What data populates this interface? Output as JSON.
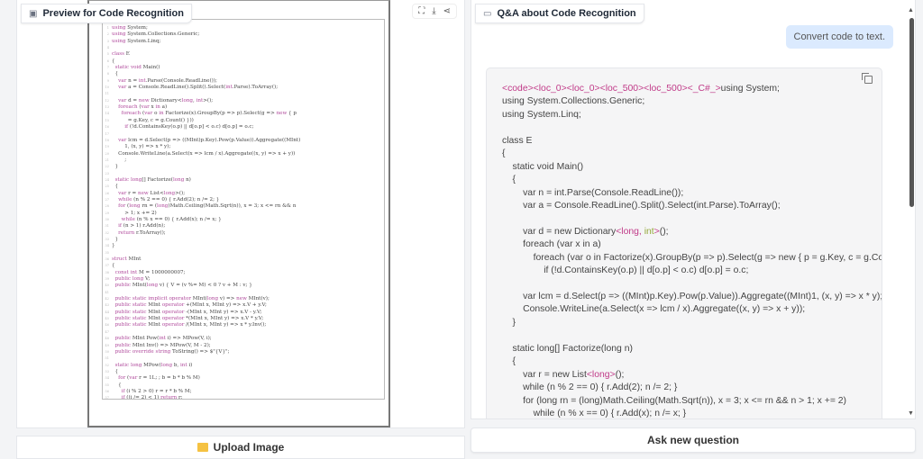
{
  "left_panel": {
    "title": "Preview for Code Recognition",
    "icons": [
      "image-icon",
      "fullscreen-icon",
      "download-icon",
      "share-icon"
    ],
    "code_image_lines": [
      "using System;",
      "using System.Collections.Generic;",
      "using System.Linq;",
      "",
      "class E",
      "{",
      "  static void Main()",
      "  {",
      "    var n = int.Parse(Console.ReadLine());",
      "    var a = Console.ReadLine().Split().Select(int.Parse).ToArray();",
      "",
      "    var d = new Dictionary<long, int>();",
      "    foreach (var x in a)",
      "      foreach (var o in Factorize(x).GroupBy(p => p).Select(g => new { p",
      "          = g.Key, c = g.Count() }))",
      "        if (!d.ContainsKey(o.p) || d[o.p] < o.c) d[o.p] = o.c;",
      "",
      "    var lcm = d.Select(p => ((MInt)p.Key).Pow(p.Value)).Aggregate((MInt)",
      "        1, (x, y) => x * y);",
      "    Console.WriteLine(a.Select(x => lcm / x).Aggregate((x, y) => x + y))",
      "        ;",
      "  }",
      "",
      "  static long[] Factorize(long n)",
      "  {",
      "    var r = new List<long>();",
      "    while (n % 2 == 0) { r.Add(2); n /= 2; }",
      "    for (long rn = (long)Math.Ceiling(Math.Sqrt(n)), x = 3; x <= rn && n",
      "        > 1; x += 2)",
      "      while (n % x == 0) { r.Add(x); n /= x; }",
      "    if (n > 1) r.Add(n);",
      "    return r.ToArray();",
      "  }",
      "}",
      "",
      "struct MInt",
      "{",
      "  const int M = 1000000007;",
      "  public long V;",
      "  public MInt(long v) { V = (v %= M) < 0 ? v + M : v; }",
      "",
      "  public static implicit operator MInt(long v) => new MInt(v);",
      "  public static MInt operator +(MInt x, MInt y) => x.V + y.V;",
      "  public static MInt operator -(MInt x, MInt y) => x.V - y.V;",
      "  public static MInt operator *(MInt x, MInt y) => x.V * y.V;",
      "  public static MInt operator /(MInt x, MInt y) => x * y.Inv();",
      "",
      "  public MInt Pow(int i) => MPow(V, i);",
      "  public MInt Inv() => MPow(V, M - 2);",
      "  public override string ToString() => $\"{V}\";",
      "",
      "  static long MPow(long b, int i)",
      "  {",
      "    for (var r = 1L; ; b = b * b % M)",
      "    {",
      "      if (i % 2 > 0) r = r * b % M;",
      "      if ((i /= 2) < 1) return r;",
      "    }",
      "  }",
      "}"
    ],
    "upload_label": "Upload Image"
  },
  "right_panel": {
    "title": "Q&A about Code Recognition",
    "user_message": "Convert code to text.",
    "answer_lines": [
      [
        {
          "t": "<code><loc_0><loc_0><loc_500><loc_500><_C#_>",
          "c": "tag"
        },
        {
          "t": "using System;"
        }
      ],
      [
        {
          "t": "using System.Collections.Generic;"
        }
      ],
      [
        {
          "t": "using System.Linq;"
        }
      ],
      [
        {
          "t": ""
        }
      ],
      [
        {
          "t": "class E"
        }
      ],
      [
        {
          "t": "{"
        }
      ],
      [
        {
          "t": "    static void Main()"
        }
      ],
      [
        {
          "t": "    {"
        }
      ],
      [
        {
          "t": "        var n = int.Parse(Console.ReadLine());"
        }
      ],
      [
        {
          "t": "        var a = Console.ReadLine().Split().Select(int.Parse).ToArray();"
        }
      ],
      [
        {
          "t": ""
        }
      ],
      [
        {
          "t": "        var d = new Dictionary"
        },
        {
          "t": "<long, ",
          "c": "tag"
        },
        {
          "t": "int",
          "c": "grn"
        },
        {
          "t": ">",
          "c": "tag"
        },
        {
          "t": "();"
        }
      ],
      [
        {
          "t": "        foreach (var x in a)"
        }
      ],
      [
        {
          "t": "            foreach (var o in Factorize(x).GroupBy(p => p).Select(g => new { p = g.Key, c = g.Count() }))"
        }
      ],
      [
        {
          "t": "                if (!d.ContainsKey(o.p) || d[o.p] < o.c) d[o.p] = o.c;"
        }
      ],
      [
        {
          "t": ""
        }
      ],
      [
        {
          "t": "        var lcm = d.Select(p => ((MInt)p.Key).Pow(p.Value)).Aggregate((MInt)1, (x, y) => x * y);"
        }
      ],
      [
        {
          "t": "        Console.WriteLine(a.Select(x => lcm / x).Aggregate((x, y) => x + y));"
        }
      ],
      [
        {
          "t": "    }"
        }
      ],
      [
        {
          "t": ""
        }
      ],
      [
        {
          "t": "    static long[] Factorize(long n)"
        }
      ],
      [
        {
          "t": "    {"
        }
      ],
      [
        {
          "t": "        var r = new List"
        },
        {
          "t": "<long>",
          "c": "tag"
        },
        {
          "t": "();"
        }
      ],
      [
        {
          "t": "        while (n % 2 == 0) { r.Add(2); n /= 2; }"
        }
      ],
      [
        {
          "t": "        for (long rn = (long)Math.Ceiling(Math.Sqrt(n)), x = 3; x <= rn && n > 1; x += 2)"
        }
      ],
      [
        {
          "t": "            while (n % x == 0) { r.Add(x); n /= x; }"
        }
      ]
    ],
    "ask_label": "Ask new question",
    "icons": [
      "chat-icon",
      "copy-icon"
    ]
  },
  "colors": {
    "tag": "#c03a88",
    "type_green": "#94a83a",
    "bubble": "#dbeafe"
  }
}
